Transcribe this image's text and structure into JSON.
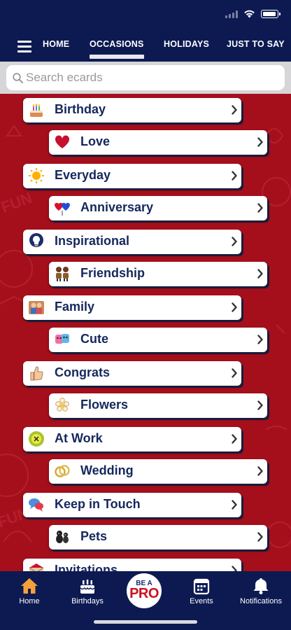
{
  "nav": {
    "tabs": [
      {
        "label": "HOME"
      },
      {
        "label": "OCCASIONS"
      },
      {
        "label": "HOLIDAYS"
      },
      {
        "label": "JUST TO SAY"
      }
    ],
    "active_tab": "OCCASIONS"
  },
  "search": {
    "placeholder": "Search ecards",
    "value": ""
  },
  "categories": [
    {
      "label": "Birthday",
      "icon": "birthday-cake-icon"
    },
    {
      "label": "Love",
      "icon": "heart-icon"
    },
    {
      "label": "Everyday",
      "icon": "sun-icon"
    },
    {
      "label": "Anniversary",
      "icon": "hearts-icon"
    },
    {
      "label": "Inspirational",
      "icon": "lightbulb-icon"
    },
    {
      "label": "Friendship",
      "icon": "friends-icon"
    },
    {
      "label": "Family",
      "icon": "family-icon"
    },
    {
      "label": "Cute",
      "icon": "cute-faces-icon"
    },
    {
      "label": "Congrats",
      "icon": "thumbs-up-icon"
    },
    {
      "label": "Flowers",
      "icon": "flower-icon"
    },
    {
      "label": "At Work",
      "icon": "work-badge-icon"
    },
    {
      "label": "Wedding",
      "icon": "rings-icon"
    },
    {
      "label": "Keep in Touch",
      "icon": "speech-bubbles-icon"
    },
    {
      "label": "Pets",
      "icon": "pets-icon"
    },
    {
      "label": "Invitations",
      "icon": "envelope-icon"
    }
  ],
  "tabbar": {
    "home": "Home",
    "birthdays": "Birthdays",
    "pro_line1": "BE A",
    "pro_line2": "PRO",
    "events": "Events",
    "notifications": "Notifications"
  },
  "colors": {
    "navy": "#0d1a52",
    "content_red": "#a50f1c",
    "label_blue": "#15285c",
    "home_icon_active": "#f3a13b"
  }
}
